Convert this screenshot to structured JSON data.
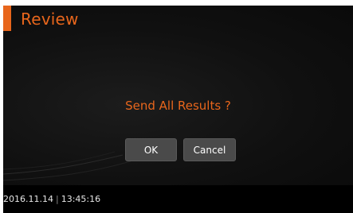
{
  "header": {
    "title": "Review"
  },
  "dialog": {
    "message": "Send All Results ?",
    "ok_label": "OK",
    "cancel_label": "Cancel"
  },
  "status_bar": {
    "date": "2016.11.14",
    "separator": "|",
    "time": "13:45:16"
  },
  "colors": {
    "accent": "#e8661c",
    "background": "#000000",
    "button": "#4a4a4a",
    "button_text": "#ffffff"
  }
}
